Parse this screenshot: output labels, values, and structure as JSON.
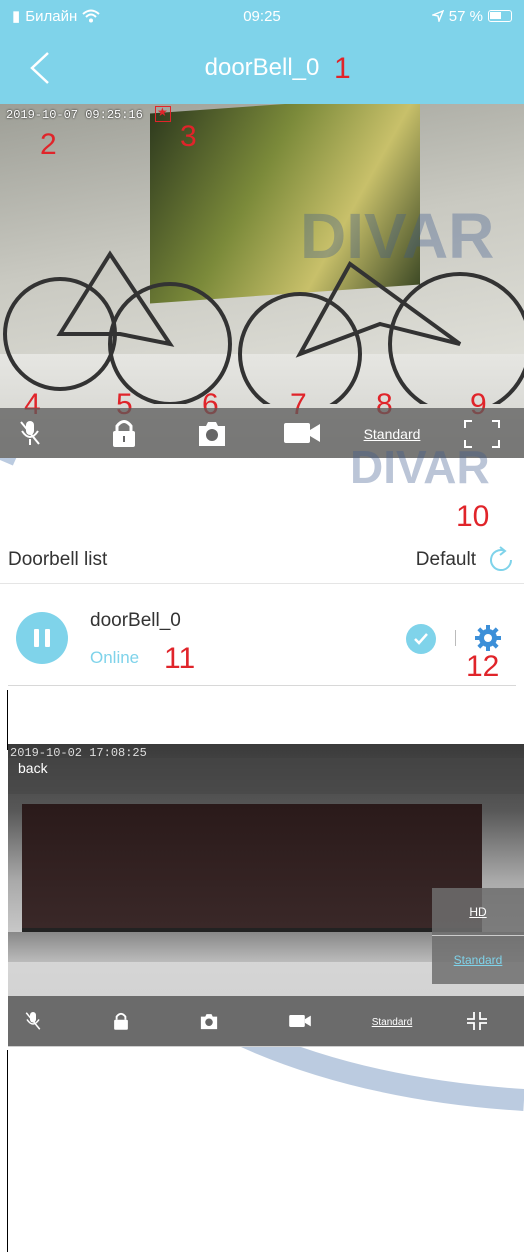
{
  "status_bar": {
    "carrier": "Билайн",
    "time": "09:25",
    "battery": "57 %"
  },
  "nav": {
    "title": "doorBell_0"
  },
  "video": {
    "timestamp": "2019-10-07 09:25:16",
    "watermark_text": "DIVAR"
  },
  "callouts": [
    "1",
    "2",
    "3",
    "4",
    "5",
    "6",
    "7",
    "8",
    "9",
    "10",
    "11",
    "12"
  ],
  "toolbar": {
    "quality": "Standard"
  },
  "list": {
    "title": "Doorbell list",
    "default_label": "Default"
  },
  "device": {
    "name": "doorBell_0",
    "status": "Online"
  },
  "fullscreen": {
    "timestamp": "2019-10-02 17:08:25",
    "back_label": "back",
    "quality_options": [
      "HD",
      "Standard"
    ],
    "quality": "Standard"
  },
  "colors": {
    "accent": "#7fd3ea",
    "callout": "#e0242a"
  },
  "icons": [
    "back-chevron-icon",
    "wifi-icon",
    "location-arrow-icon",
    "battery-icon",
    "mic-mute-icon",
    "lock-icon",
    "camera-icon",
    "video-camera-icon",
    "fullscreen-icon",
    "refresh-icon",
    "pause-icon",
    "check-icon",
    "gear-icon",
    "exit-fullscreen-icon"
  ]
}
